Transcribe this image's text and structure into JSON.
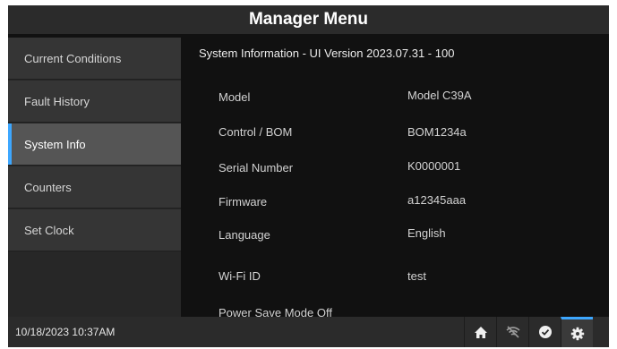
{
  "header": {
    "title": "Manager Menu"
  },
  "sidebar": {
    "items": [
      {
        "label": "Current Conditions"
      },
      {
        "label": "Fault History"
      },
      {
        "label": "System Info",
        "active": true
      },
      {
        "label": "Counters"
      },
      {
        "label": "Set Clock"
      }
    ]
  },
  "content": {
    "title": "System Information - UI Version 2023.07.31 - 100",
    "rows": [
      {
        "label": "Model",
        "value": "Model C39A"
      },
      {
        "label": "Control / BOM",
        "value": "BOM1234a"
      },
      {
        "label": "Serial Number",
        "value": "K0000001"
      },
      {
        "label": "Firmware",
        "value": "a12345aaa"
      },
      {
        "label": "Language",
        "value": "English"
      },
      {
        "label": "Wi-Fi ID",
        "value": "test"
      }
    ],
    "partial_row": "Power Save Mode Off"
  },
  "footer": {
    "datetime": "10/18/2023 10:37AM",
    "buttons": [
      {
        "icon": "home-icon"
      },
      {
        "icon": "wifi-off-icon"
      },
      {
        "icon": "check-circle-icon"
      },
      {
        "icon": "gear-icon",
        "active": true
      }
    ]
  },
  "colors": {
    "accent": "#3da7ff",
    "background": "#111111",
    "panel": "#2b2b2b"
  }
}
